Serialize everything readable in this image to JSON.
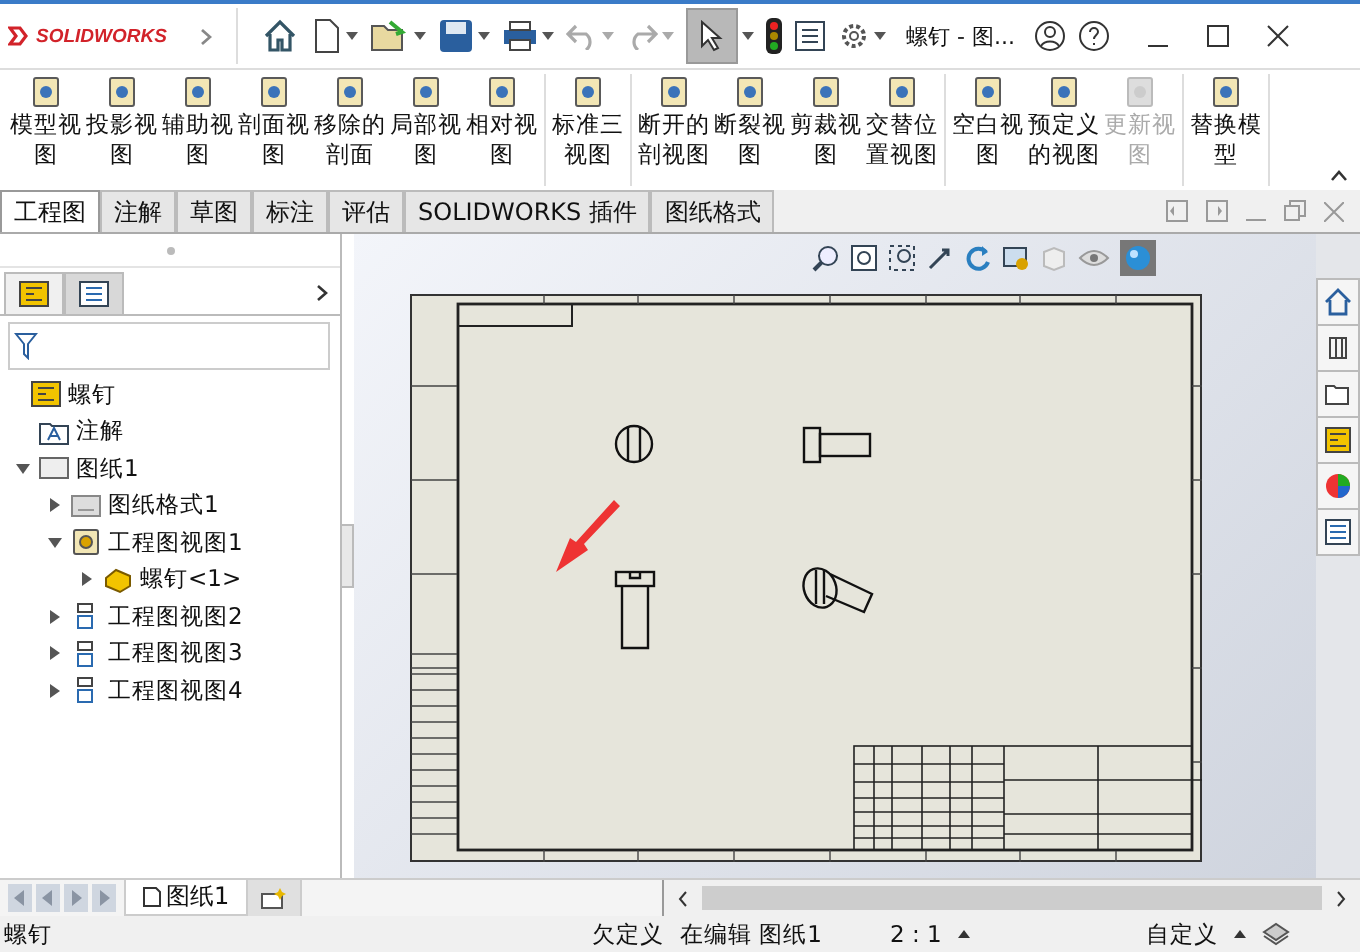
{
  "titlebar": {
    "logo": "SOLIDWORKS",
    "document": "螺钉 - 图..."
  },
  "ribbon": {
    "groups": [
      [
        {
          "label": "模型视图",
          "disabled": false
        },
        {
          "label": "投影视图",
          "disabled": false
        },
        {
          "label": "辅助视图",
          "disabled": false
        },
        {
          "label": "剖面视图",
          "disabled": false
        },
        {
          "label": "移除的剖面",
          "disabled": false
        },
        {
          "label": "局部视图",
          "disabled": false
        },
        {
          "label": "相对视图",
          "disabled": false
        }
      ],
      [
        {
          "label": "标准三视图",
          "disabled": false
        }
      ],
      [
        {
          "label": "断开的剖视图",
          "disabled": false
        },
        {
          "label": "断裂视图",
          "disabled": false
        },
        {
          "label": "剪裁视图",
          "disabled": false
        },
        {
          "label": "交替位置视图",
          "disabled": false
        }
      ],
      [
        {
          "label": "空白视图",
          "disabled": false
        },
        {
          "label": "预定义的视图",
          "disabled": false
        },
        {
          "label": "更新视图",
          "disabled": true
        }
      ],
      [
        {
          "label": "替换模型",
          "disabled": false
        }
      ]
    ]
  },
  "tabs": [
    {
      "label": "工程图",
      "selected": true
    },
    {
      "label": "注解",
      "selected": false
    },
    {
      "label": "草图",
      "selected": false
    },
    {
      "label": "标注",
      "selected": false
    },
    {
      "label": "评估",
      "selected": false
    },
    {
      "label": "SOLIDWORKS 插件",
      "selected": false
    },
    {
      "label": "图纸格式",
      "selected": false
    }
  ],
  "panel_tabs": [
    {
      "selected": true
    },
    {
      "selected": false
    }
  ],
  "feature_tree": {
    "label": "螺钉",
    "kind": "part",
    "children": [
      {
        "label": "注解",
        "kind": "annotation"
      },
      {
        "label": "图纸1",
        "kind": "sheet",
        "expanded": true,
        "children": [
          {
            "label": "图纸格式1",
            "kind": "format",
            "expanded": false
          },
          {
            "label": "工程图视图1",
            "kind": "view",
            "expanded": true,
            "children": [
              {
                "label": "螺钉<1>",
                "kind": "component",
                "expanded": false
              }
            ]
          },
          {
            "label": "工程图视图2",
            "kind": "projected",
            "expanded": false
          },
          {
            "label": "工程图视图3",
            "kind": "projected",
            "expanded": false
          },
          {
            "label": "工程图视图4",
            "kind": "projected",
            "expanded": false
          }
        ]
      }
    ]
  },
  "sheet_tabs": [
    {
      "label": "图纸1",
      "selected": true
    }
  ],
  "status_bar": {
    "document": "螺钉",
    "state": "欠定义",
    "editing": "在编辑 图纸1",
    "scale": "2 : 1",
    "units": "自定义"
  }
}
